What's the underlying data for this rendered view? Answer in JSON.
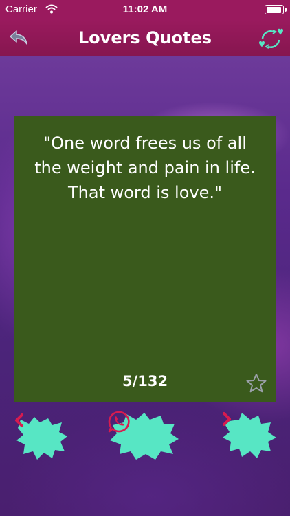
{
  "status_bar": {
    "carrier": "Carrier",
    "time": "11:02 AM"
  },
  "header": {
    "title": "Lovers Quotes",
    "back_icon": "reply-arrow-icon",
    "refresh_icon": "heart-refresh-icon"
  },
  "quote": {
    "text": "\"One word frees us of all the weight and pain in life. That word is love.\"",
    "counter": "5/132",
    "favorite_icon": "star-outline-icon"
  },
  "controls": {
    "prev_icon": "chevron-left-icon",
    "share_icon": "whatsapp-icon",
    "next_icon": "chevron-right-icon"
  },
  "colors": {
    "header": "#9a1a5e",
    "card": "#3a5a1c",
    "accent_teal": "#57e6c4",
    "accent_pink": "#d81b4f",
    "background": "#4a2076"
  }
}
